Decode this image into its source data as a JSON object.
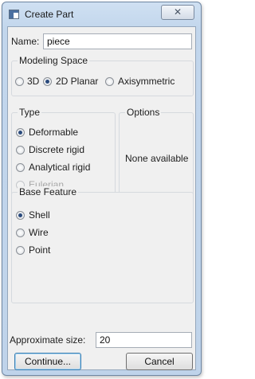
{
  "window": {
    "title": "Create Part",
    "close_glyph": "✕"
  },
  "name": {
    "label": "Name:",
    "value": "piece"
  },
  "modeling_space": {
    "label": "Modeling Space",
    "options": [
      {
        "label": "3D",
        "selected": false
      },
      {
        "label": "2D Planar",
        "selected": true
      },
      {
        "label": "Axisymmetric",
        "selected": false
      }
    ]
  },
  "type": {
    "label": "Type",
    "options": [
      {
        "label": "Deformable",
        "selected": true,
        "enabled": true
      },
      {
        "label": "Discrete rigid",
        "selected": false,
        "enabled": true
      },
      {
        "label": "Analytical rigid",
        "selected": false,
        "enabled": true
      },
      {
        "label": "Eulerian",
        "selected": false,
        "enabled": false
      }
    ]
  },
  "options_group": {
    "label": "Options",
    "text": "None available"
  },
  "base_feature": {
    "label": "Base Feature",
    "options": [
      {
        "label": "Shell",
        "selected": true
      },
      {
        "label": "Wire",
        "selected": false
      },
      {
        "label": "Point",
        "selected": false
      }
    ]
  },
  "approx_size": {
    "label": "Approximate size:",
    "value": "20"
  },
  "buttons": {
    "continue": "Continue...",
    "cancel": "Cancel"
  }
}
